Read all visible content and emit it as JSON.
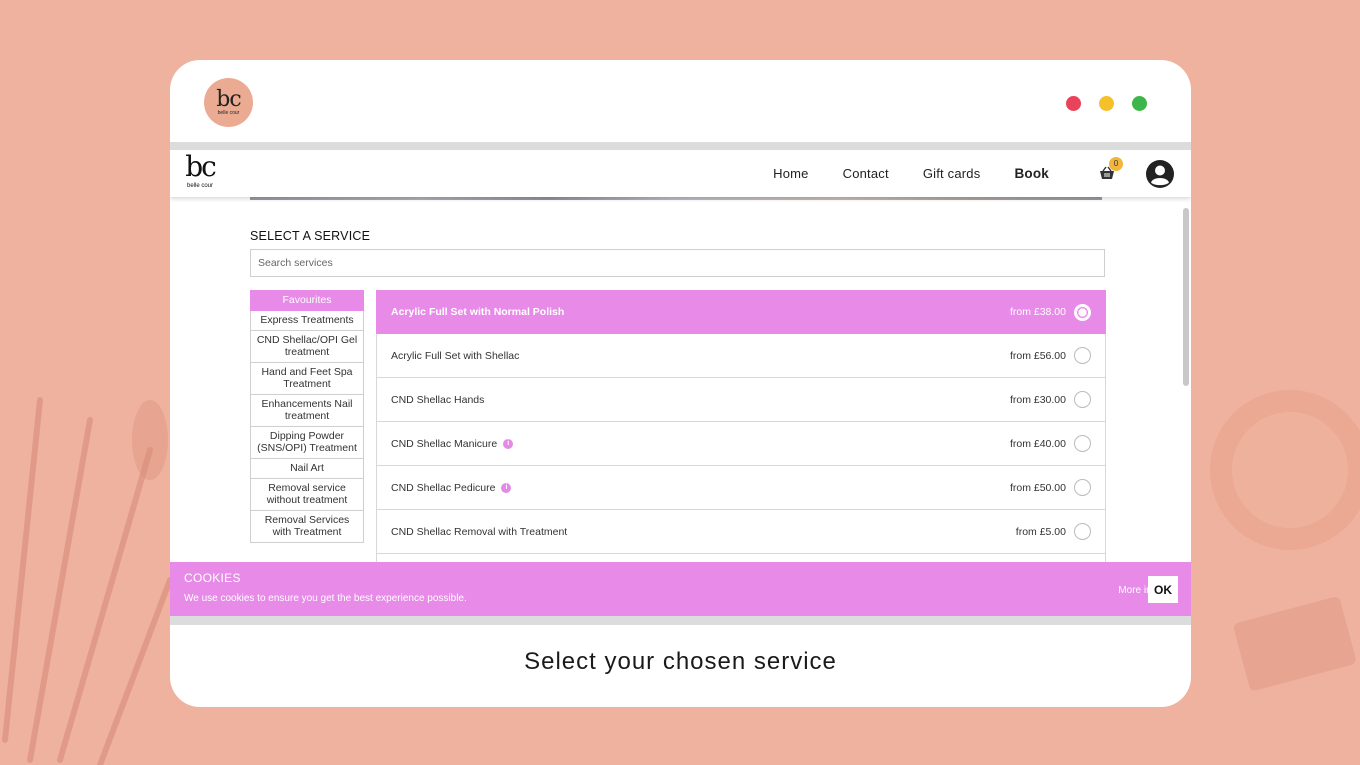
{
  "outer": {
    "logo_mark": "bc",
    "logo_sub": "belle cour",
    "caption": "Select your chosen service",
    "window_dots": [
      {
        "name": "close",
        "color": "#e8435a"
      },
      {
        "name": "minimize",
        "color": "#f6c02b"
      },
      {
        "name": "maximize",
        "color": "#3cb64a"
      }
    ]
  },
  "nav": {
    "logo_mark": "bc",
    "logo_sub": "belle cour",
    "links": [
      "Home",
      "Contact",
      "Gift cards",
      "Book"
    ],
    "basket_count": "0"
  },
  "main": {
    "section_title": "SELECT A SERVICE",
    "search_placeholder": "Search services"
  },
  "categories": [
    "Favourites",
    "Express Treatments",
    "CND Shellac/OPI Gel treatment",
    "Hand and Feet Spa Treatment",
    "Enhancements Nail treatment",
    "Dipping Powder (SNS/OPI) Treatment",
    "Nail Art",
    "Removal service without treatment",
    "Removal Services with Treatment"
  ],
  "services": [
    {
      "name": "Acrylic Full Set with Normal Polish",
      "price": "from £38.00",
      "info": false,
      "selected": true
    },
    {
      "name": "Acrylic Full Set with Shellac",
      "price": "from £56.00",
      "info": false,
      "selected": false
    },
    {
      "name": "CND Shellac Hands",
      "price": "from £30.00",
      "info": false,
      "selected": false
    },
    {
      "name": "CND Shellac Manicure",
      "price": "from £40.00",
      "info": true,
      "selected": false
    },
    {
      "name": "CND Shellac Pedicure",
      "price": "from £50.00",
      "info": true,
      "selected": false
    },
    {
      "name": "CND Shellac Removal with Treatment",
      "price": "from £5.00",
      "info": false,
      "selected": false
    }
  ],
  "cookie": {
    "title": "COOKIES",
    "text": "We use cookies to ensure you get the best experience possible.",
    "more_label": "More info",
    "ok_label": "OK"
  },
  "colors": {
    "accent": "#e88ae8",
    "background": "#efb29f",
    "badge": "#f3b63c"
  }
}
